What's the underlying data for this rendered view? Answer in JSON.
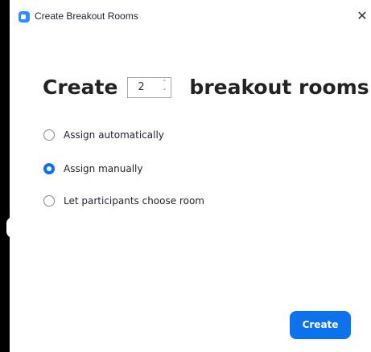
{
  "window": {
    "title": "Create Breakout Rooms",
    "close_glyph": "✕"
  },
  "header": {
    "prefix": "Create",
    "room_count": "2",
    "suffix": "breakout rooms",
    "stepper_up_glyph": "˄",
    "stepper_down_glyph": "˅"
  },
  "options": [
    {
      "label": "Assign automatically",
      "selected": false
    },
    {
      "label": "Assign manually",
      "selected": true
    },
    {
      "label": "Let participants choose room",
      "selected": false
    }
  ],
  "footer": {
    "create_label": "Create"
  },
  "colors": {
    "accent": "#0e72ed",
    "app_icon": "#2d8cff"
  },
  "icons": {
    "app": "zoom-app-icon",
    "close": "close-icon"
  }
}
